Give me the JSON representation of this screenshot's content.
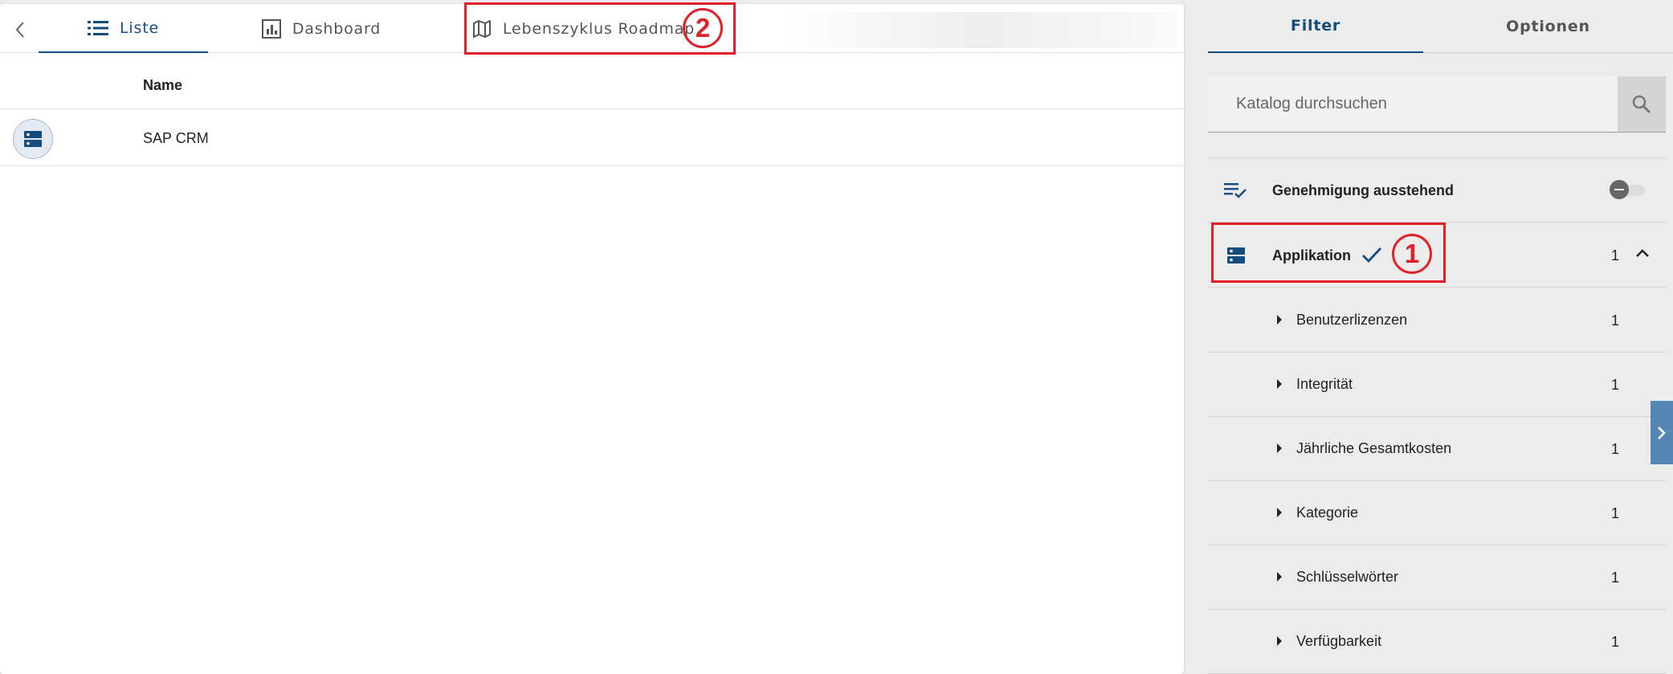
{
  "main_tabs": {
    "liste": "Liste",
    "dashboard": "Dashboard",
    "roadmap": "Lebenszyklus Roadmap"
  },
  "table": {
    "column_header": "Name",
    "rows": [
      {
        "name": "SAP CRM",
        "icon": "application-icon"
      }
    ]
  },
  "side_tabs": {
    "filter": "Filter",
    "optionen": "Optionen"
  },
  "search": {
    "placeholder": "Katalog durchsuchen",
    "value": ""
  },
  "filters": {
    "approval": {
      "label": "Genehmigung ausstehend",
      "toggle_state": "neutral"
    },
    "application": {
      "label": "Applikation",
      "count": "1",
      "checked": true,
      "expanded": true
    },
    "subfilters": [
      {
        "label": "Benutzerlizenzen",
        "count": "1"
      },
      {
        "label": "Integrität",
        "count": "1"
      },
      {
        "label": "Jährliche Gesamtkosten",
        "count": "1"
      },
      {
        "label": "Kategorie",
        "count": "1"
      },
      {
        "label": "Schlüsselwörter",
        "count": "1"
      },
      {
        "label": "Verfügbarkeit",
        "count": "1"
      }
    ]
  },
  "annotations": {
    "marker1": "1",
    "marker2": "2"
  },
  "colors": {
    "accent": "#154c7e",
    "annotation": "#e0212a",
    "panel_bg": "#ececec",
    "expand_tab": "#5686b3"
  }
}
